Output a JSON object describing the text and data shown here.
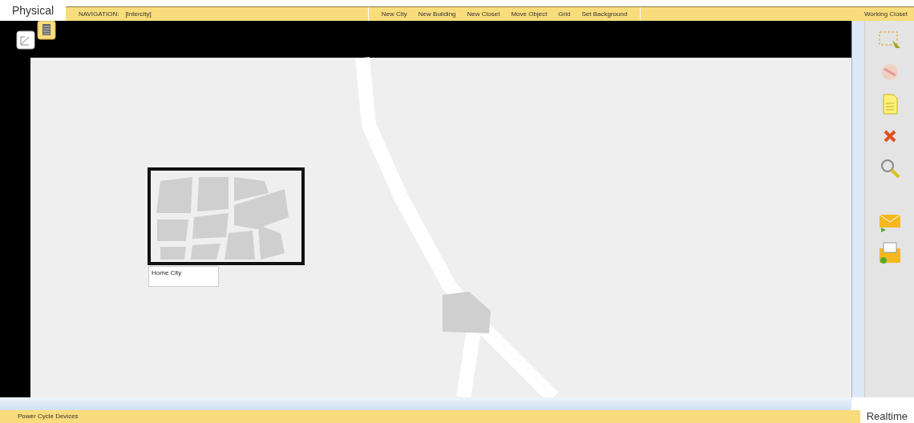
{
  "mode_tab": "Physical",
  "navigation": {
    "label": "NAVIGATION:",
    "location": "[Intercity]"
  },
  "toolbar": [
    "New City",
    "New Building",
    "New Closet",
    "Move Object",
    "Grid",
    "Set Background"
  ],
  "working_closet": "Working Closet",
  "canvas": {
    "objects": [
      {
        "kind": "city",
        "label": "Home City"
      },
      {
        "kind": "building"
      }
    ]
  },
  "status_bar": "Power Cycle Devices",
  "time_tab": "Realtime"
}
